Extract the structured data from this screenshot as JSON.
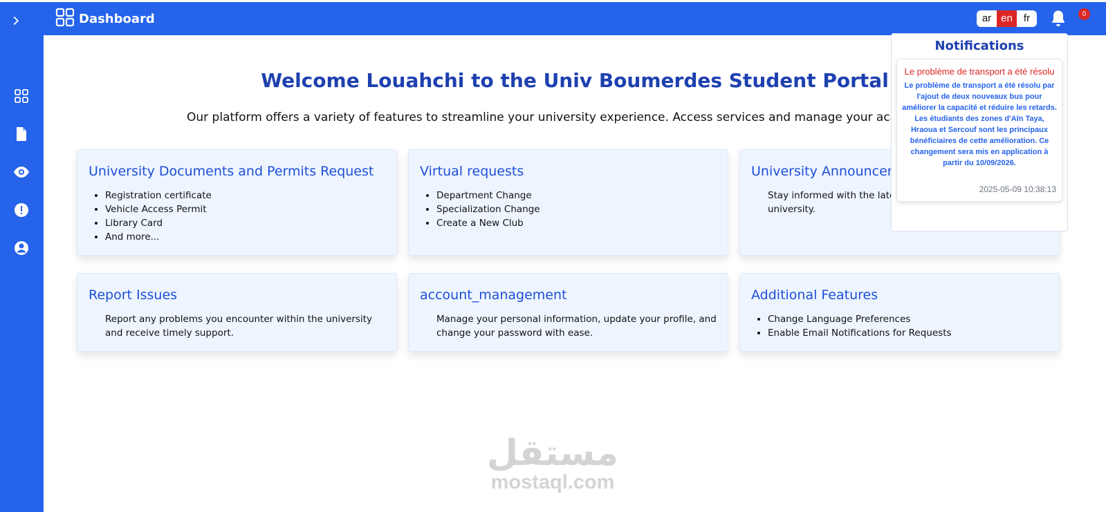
{
  "sidebar": {
    "items": [
      {
        "icon": "grid-icon"
      },
      {
        "icon": "document-icon"
      },
      {
        "icon": "eye-icon"
      },
      {
        "icon": "alert-icon"
      },
      {
        "icon": "user-circle-icon"
      }
    ]
  },
  "header": {
    "title": "Dashboard",
    "languages": [
      "ar",
      "en",
      "fr"
    ],
    "active_language": "en",
    "notification_count": "0"
  },
  "main": {
    "welcome": "Welcome Louahchi to the Univ Boumerdes Student Portal",
    "intro": "Our platform offers a variety of features to streamline your university experience. Access services and manage your academic needs"
  },
  "cards": [
    {
      "title": "University Documents and Permits Request",
      "items": [
        "Registration certificate",
        "Vehicle Access Permit",
        "Library Card",
        "And more..."
      ]
    },
    {
      "title": "Virtual requests",
      "items": [
        "Department Change",
        "Specialization Change",
        "Create a New Club"
      ]
    },
    {
      "title": "University Announcements",
      "text": "Stay informed with the latest announcements from the university."
    },
    {
      "title": "Report Issues",
      "text": "Report any problems you encounter within the university and receive timely support."
    },
    {
      "title": "account_management",
      "text": "Manage your personal information, update your profile, and change your password with ease."
    },
    {
      "title": "Additional Features",
      "items": [
        "Change Language Preferences",
        "Enable Email Notifications for Requests"
      ]
    }
  ],
  "notifications": {
    "title": "Notifications",
    "items": [
      {
        "heading": "Le problème de transport a été résolu",
        "body": "Le problème de transport a été résolu par l'ajout de deux nouveaux bus pour améliorer la capacité et réduire les retards. Les étudiants des zones d'Aïn Taya, Hraoua et Sercouf sont les principaux bénéficiaires de cette amélioration. Ce changement sera mis en application à partir du 10/09/2026.",
        "timestamp": "2025-05-09 10:38:13"
      }
    ]
  },
  "watermark": {
    "arabic": "مستقل",
    "latin": "mostaql.com"
  },
  "colors": {
    "primary": "#2563eb",
    "heading": "#1e40af",
    "card_bg": "#eef5ff",
    "danger": "#dc2626"
  }
}
